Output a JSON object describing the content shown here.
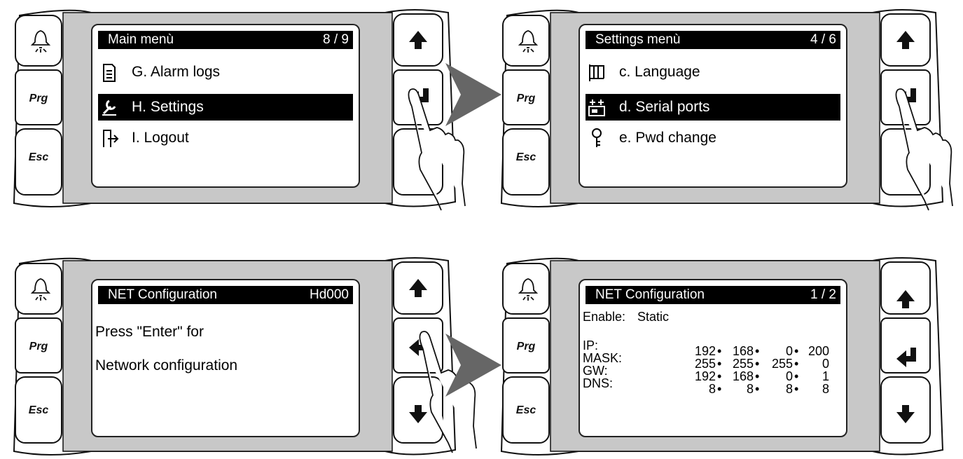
{
  "panels": [
    {
      "title": "Main menù",
      "counter": "8 / 9",
      "items": [
        {
          "label": "G. Alarm logs",
          "icon": "document-icon",
          "selected": false
        },
        {
          "label": "H. Settings",
          "icon": "wrench-icon",
          "selected": true
        },
        {
          "label": "I. Logout",
          "icon": "logout-icon",
          "selected": false
        }
      ]
    },
    {
      "title": "Settings menù",
      "counter": "4 / 6",
      "items": [
        {
          "label": "c. Language",
          "icon": "flag-icon",
          "selected": false
        },
        {
          "label": "d. Serial ports",
          "icon": "serial-port-icon",
          "selected": true
        },
        {
          "label": "e. Pwd change",
          "icon": "key-icon",
          "selected": false
        }
      ]
    },
    {
      "title": "NET Configuration",
      "counter": "Hd000",
      "lines": [
        "Press \"Enter\" for",
        "Network configuration"
      ]
    },
    {
      "title": "NET Configuration",
      "counter": "1 / 2",
      "enable_label": "Enable:",
      "enable_value": "Static",
      "fields": [
        {
          "label": "IP:",
          "octets": [
            "192",
            "168",
            "0",
            "200"
          ]
        },
        {
          "label": "MASK:",
          "octets": [
            "255",
            "255",
            "255",
            "0"
          ]
        },
        {
          "label": "GW:",
          "octets": [
            "192",
            "168",
            "0",
            "1"
          ]
        },
        {
          "label": "DNS:",
          "octets": [
            "8",
            "8",
            "8",
            "8"
          ]
        }
      ]
    }
  ],
  "keys": {
    "alarm": "bell-icon",
    "prg": "Prg",
    "esc": "Esc",
    "up": "up-arrow-icon",
    "enter": "enter-icon",
    "down": "down-arrow-icon"
  },
  "colors": {
    "bezel": "#c8c8c8",
    "screen_bg": "#ffffff",
    "title_bg": "#000000",
    "pointer_arrow": "#666666"
  }
}
